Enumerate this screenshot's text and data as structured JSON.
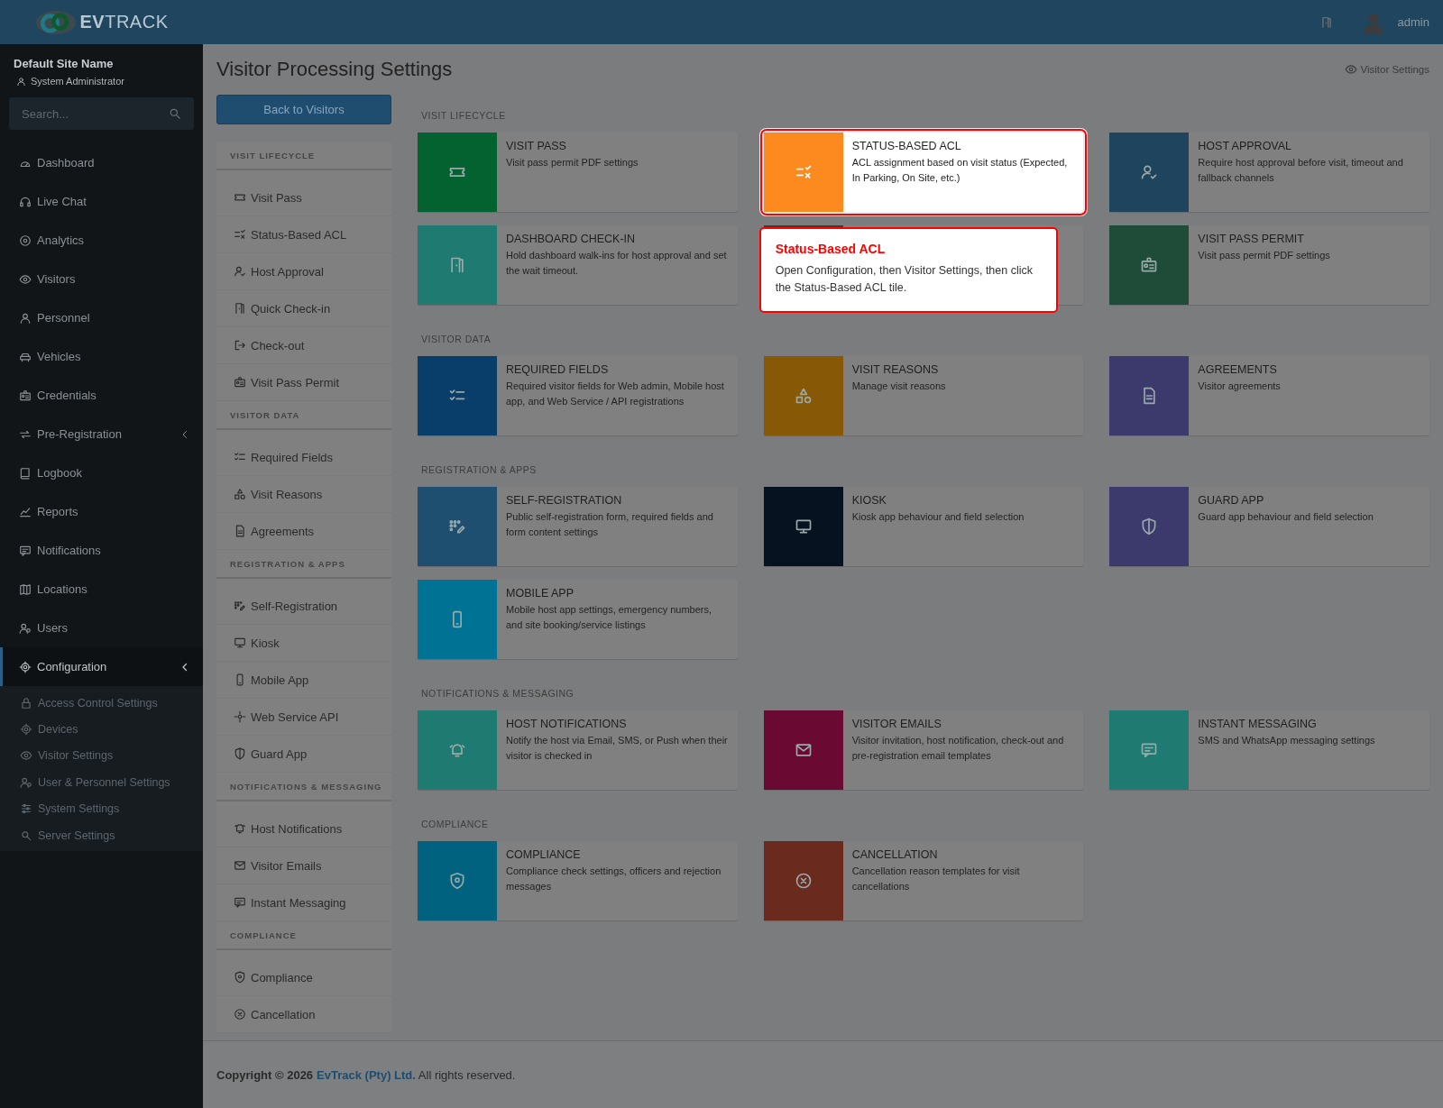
{
  "header": {
    "brand": "**EV**TRACK",
    "user": "admin"
  },
  "sidebar": {
    "site_name": "Default Site Name",
    "role": "System Administrator",
    "search": {
      "placeholder": "Search..."
    },
    "items": [
      {
        "label": "Dashboard",
        "selected": false
      },
      {
        "label": "Live Chat",
        "selected": false
      },
      {
        "label": "Analytics",
        "selected": false
      },
      {
        "label": "Visitors",
        "selected": false
      },
      {
        "label": "Personnel",
        "selected": false
      },
      {
        "label": "Vehicles",
        "selected": false
      },
      {
        "label": "Credentials",
        "selected": false
      },
      {
        "label": "Pre-Registration",
        "selected": false,
        "expanded": false
      },
      {
        "label": "Logbook",
        "selected": false
      },
      {
        "label": "Reports",
        "selected": false
      },
      {
        "label": "Notifications",
        "selected": false
      },
      {
        "label": "Locations",
        "selected": false
      },
      {
        "label": "Users",
        "selected": false
      },
      {
        "label": "Configuration",
        "selected": true,
        "expanded": true,
        "children": [
          {
            "label": "Access Control Settings",
            "selected": false
          },
          {
            "label": "Devices",
            "selected": false
          },
          {
            "label": "Visitor Settings",
            "selected": false
          },
          {
            "label": "User & Personnel Settings",
            "selected": false
          },
          {
            "label": "System Settings",
            "selected": false
          },
          {
            "label": "Server Settings",
            "selected": false
          }
        ]
      }
    ]
  },
  "page": {
    "title": "Visitor Processing Settings",
    "breadcrumb": "Visitor Settings",
    "back_button": "Back to Visitors"
  },
  "nav": {
    "sections": [
      {
        "heading": "VISIT LIFECYCLE",
        "items": [
          "Visit Pass",
          "Status-Based ACL",
          "Host Approval",
          "Quick Check-in",
          "Check-out",
          "Visit Pass Permit"
        ]
      },
      {
        "heading": "VISITOR DATA",
        "items": [
          "Required Fields",
          "Visit Reasons",
          "Agreements"
        ]
      },
      {
        "heading": "REGISTRATION & APPS",
        "items": [
          "Self-Registration",
          "Kiosk",
          "Mobile App",
          "Web Service API",
          "Guard App"
        ]
      },
      {
        "heading": "NOTIFICATIONS & MESSAGING",
        "items": [
          "Host Notifications",
          "Visitor Emails",
          "Instant Messaging"
        ]
      },
      {
        "heading": "COMPLIANCE",
        "items": [
          "Compliance",
          "Cancellation"
        ]
      }
    ]
  },
  "tiles": {
    "sections": [
      {
        "heading": "VISIT LIFECYCLE",
        "tiles": [
          {
            "title": "VISIT PASS",
            "description": "Visit pass permit PDF settings",
            "color": "#03622f",
            "highlighted": false
          },
          {
            "title": "STATUS-BASED ACL",
            "description": "ACL assignment based on visit status (Expected, In Parking, On Site, etc.)",
            "color": "#fd8a1e",
            "highlighted": true
          },
          {
            "title": "HOST APPROVAL",
            "description": "Require host approval before visit, timeout and fallback channels",
            "color": "#1f445e",
            "highlighted": false
          },
          {
            "title": "DASHBOARD CHECK-IN",
            "description": "Hold dashboard walk-ins for host approval and set the wait timeout.",
            "color": "#1f7a72",
            "highlighted": false
          },
          {
            "color": "#3a3a3a",
            "highlighted": false
          },
          {
            "title": "VISIT PASS PERMIT",
            "description": "Visit pass permit PDF settings",
            "color": "#1f4c39",
            "highlighted": false
          }
        ]
      },
      {
        "heading": "VISITOR DATA",
        "tiles": [
          {
            "title": "REQUIRED FIELDS",
            "description": "Required visitor fields for Web admin, Mobile host app, and Web Service / API registrations",
            "color": "#0a3e6a",
            "highlighted": false
          },
          {
            "title": "VISIT REASONS",
            "description": "Manage visit reasons",
            "color": "#875806",
            "highlighted": false
          },
          {
            "title": "AGREEMENTS",
            "description": "Visitor agreements",
            "color": "#3c3a6c",
            "highlighted": false
          }
        ]
      },
      {
        "heading": "REGISTRATION & APPS",
        "tiles": [
          {
            "title": "SELF-REGISTRATION",
            "description": "Public self-registration form, required fields and form content settings",
            "color": "#1f4f70",
            "highlighted": false
          },
          {
            "title": "KIOSK",
            "description": "Kiosk app behaviour and field selection",
            "color": "#06121f",
            "highlighted": false
          },
          {
            "title": "GUARD APP",
            "description": "Guard app behaviour and field selection",
            "color": "#3c3a6c",
            "highlighted": false
          },
          {
            "title": "MOBILE APP",
            "description": "Mobile host app settings, emergency numbers, and site booking/service listings",
            "color": "#007294",
            "highlighted": false
          }
        ]
      },
      {
        "heading": "NOTIFICATIONS & MESSAGING",
        "tiles": [
          {
            "title": "HOST NOTIFICATIONS",
            "description": "Notify the host via Email, SMS, or Push when their visitor is checked in",
            "color": "#1f7a72",
            "highlighted": false
          },
          {
            "title": "VISITOR EMAILS",
            "description": "Visitor invitation, host notification, check-out and pre-registration email templates",
            "color": "#6a0a33",
            "highlighted": false
          },
          {
            "title": "INSTANT MESSAGING",
            "description": "SMS and WhatsApp messaging settings",
            "color": "#1f7a72",
            "highlighted": false
          }
        ]
      },
      {
        "heading": "COMPLIANCE",
        "tiles": [
          {
            "title": "COMPLIANCE",
            "description": "Compliance check settings, officers and rejection messages",
            "color": "#00627e",
            "highlighted": false
          },
          {
            "title": "CANCELLATION",
            "description": "Cancellation reason templates for visit cancellations",
            "color": "#6a2a1e",
            "highlighted": false
          }
        ]
      }
    ]
  },
  "tooltip": {
    "title": "Status-Based ACL",
    "text": "Open Configuration, then Visitor Settings, then click the Status-Based ACL tile."
  },
  "footer": {
    "copyright": "Copyright © 2026",
    "company": "EvTrack (Pty) Ltd.",
    "rights": "All rights reserved."
  }
}
